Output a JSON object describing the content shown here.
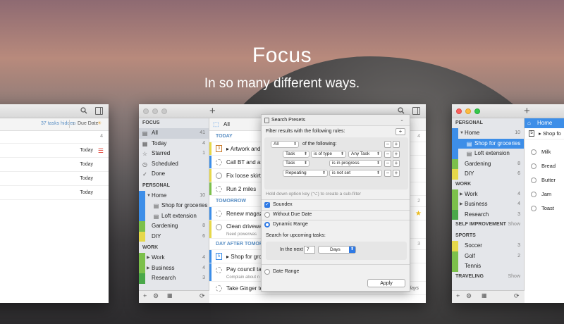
{
  "hero": {
    "title": "Focus",
    "subtitle": "In so many different ways."
  },
  "left_window": {
    "filter_text": "37 tasks hidden",
    "sort_label": "Due Date",
    "count_top": "4",
    "tasks": [
      {
        "due": "Today"
      },
      {
        "due": "Today"
      },
      {
        "due": "Today"
      },
      {
        "due": "Today"
      }
    ]
  },
  "mid_window": {
    "sidebar": {
      "focus_header": "FOCUS",
      "focus_items": [
        {
          "label": "All",
          "count": "41"
        },
        {
          "label": "Today",
          "count": "4"
        },
        {
          "label": "Starred",
          "count": "1"
        },
        {
          "label": "Scheduled",
          "count": ""
        },
        {
          "label": "Done",
          "count": ""
        }
      ],
      "personal_header": "PERSONAL",
      "personal_items": [
        {
          "label": "Home",
          "count": "10"
        },
        {
          "label": "Shop for groceries",
          "count": ""
        },
        {
          "label": "Loft extension",
          "count": ""
        },
        {
          "label": "Gardening",
          "count": "8"
        },
        {
          "label": "DIY",
          "count": "6"
        }
      ],
      "work_header": "WORK",
      "work_items": [
        {
          "label": "Work",
          "count": "4"
        },
        {
          "label": "Business",
          "count": "4"
        },
        {
          "label": "Research",
          "count": "3"
        }
      ]
    },
    "list_header": "All",
    "sections": {
      "today": "TODAY",
      "today_count": "4",
      "tomorrow": "TOMORROW",
      "tomorrow_count": "2",
      "day_after": "DAY AFTER TOMORROW",
      "day_after_count": "3"
    },
    "tasks_today": [
      "Artwork and",
      "Call BT and ask",
      "Fix loose skirting",
      "Run 2 miles"
    ],
    "tasks_tomorrow": [
      {
        "title": "Renew magazine",
        "sub": ""
      },
      {
        "title": "Clean driveway",
        "sub": "Need powerwas"
      }
    ],
    "tasks_day_after": [
      {
        "title": "Shop for groc",
        "sub": ""
      },
      {
        "title": "Pay council tax",
        "sub": "Complain about n"
      },
      {
        "title": "Take Ginger to vet",
        "sub": "",
        "date": "In 2 days"
      }
    ]
  },
  "popover": {
    "title": "Search Presets",
    "filter_intro": "Filter results with the following rules:",
    "match_select": "All",
    "match_suffix": "of the following:",
    "rules": [
      {
        "field": "Task",
        "op": "is of type",
        "value": "Any Task"
      },
      {
        "field": "Task",
        "op": "is in progress",
        "value": ""
      },
      {
        "field": "Repeating",
        "op": "is not set",
        "value": ""
      }
    ],
    "hint": "Hold down option key (⌥) to create a sub-filter",
    "soundex": "Soundex",
    "without_due": "Without Due Date",
    "dynamic_range": "Dynamic Range",
    "search_upcoming": "Search for upcoming tasks:",
    "in_the_next": "In the next",
    "days_value": "7",
    "days_unit": "Days",
    "date_range": "Date Range",
    "apply": "Apply"
  },
  "right_window": {
    "sidebar": {
      "personal_header": "PERSONAL",
      "items": [
        {
          "label": "Home",
          "count": "10"
        },
        {
          "label": "Shop for groceries",
          "count": ""
        },
        {
          "label": "Loft extension",
          "count": ""
        },
        {
          "label": "Gardening",
          "count": "8"
        },
        {
          "label": "DIY",
          "count": "6"
        }
      ],
      "work_header": "WORK",
      "work_items": [
        {
          "label": "Work",
          "count": "4"
        },
        {
          "label": "Business",
          "count": "4"
        },
        {
          "label": "Research",
          "count": "3"
        }
      ],
      "self_header": "SELF IMPROVEMENT",
      "self_show": "Show",
      "sports_header": "SPORTS",
      "sports_items": [
        {
          "label": "Soccer",
          "count": "3"
        },
        {
          "label": "Golf",
          "count": "2"
        },
        {
          "label": "Tennis",
          "count": ""
        }
      ],
      "travel_header": "TRAVELING",
      "travel_show": "Show"
    },
    "tab": "Home",
    "list_title": "Shop fo",
    "items": [
      "Milk",
      "Bread",
      "Butter",
      "Jam",
      "Toast"
    ]
  },
  "colors": {
    "accent": "#3d8ee8",
    "section_blue": "#5a8fc4"
  }
}
